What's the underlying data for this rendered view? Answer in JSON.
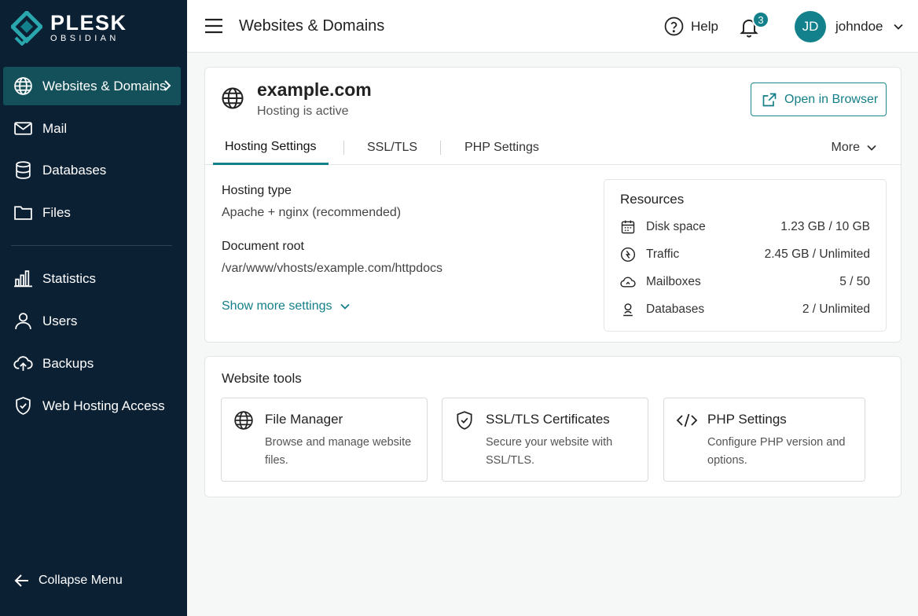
{
  "brand": {
    "name": "PLESK",
    "edition": "OBSIDIAN",
    "accent": "#13818b",
    "sidebar_bg": "#0c2034"
  },
  "sidebar": {
    "items": [
      {
        "label": "Websites & Domains",
        "icon": "globe-icon",
        "active": true
      },
      {
        "label": "Mail",
        "icon": "mail-icon"
      },
      {
        "label": "Databases",
        "icon": "database-icon"
      },
      {
        "label": "Files",
        "icon": "folder-icon"
      },
      {
        "label": "Statistics",
        "icon": "bar-chart-icon"
      },
      {
        "label": "Users",
        "icon": "user-icon"
      },
      {
        "label": "Backups",
        "icon": "cloud-upload-icon"
      },
      {
        "label": "Web Hosting Access",
        "icon": "shield-icon"
      }
    ],
    "collapse_label": "Collapse Menu"
  },
  "header": {
    "title": "Websites & Domains",
    "help_label": "Help",
    "notifications_count": "3",
    "user_initials": "JD",
    "username": "johndoe"
  },
  "domain": {
    "name": "example.com",
    "status": "Hosting is active",
    "open_browser_label": "Open in Browser",
    "tabs": [
      {
        "label": "Hosting Settings",
        "active": true
      },
      {
        "label": "SSL/TLS"
      },
      {
        "label": "PHP Settings"
      }
    ],
    "more_label": "More",
    "hosting_type_label": "Hosting type",
    "hosting_type_value": "Apache + nginx (recommended)",
    "document_root_label": "Document root",
    "document_root_value": "/var/www/vhosts/example.com/httpdocs",
    "show_more_label": "Show more settings"
  },
  "resources": {
    "title": "Resources",
    "rows": [
      {
        "label": "Disk space",
        "value": "1.23 GB / 10 GB",
        "icon": "calendar-icon"
      },
      {
        "label": "Traffic",
        "value": "2.45 GB / Unlimited",
        "icon": "traffic-icon"
      },
      {
        "label": "Mailboxes",
        "value": "5 / 50",
        "icon": "cloud-icon"
      },
      {
        "label": "Databases",
        "value": "2 / Unlimited",
        "icon": "database-user-icon"
      }
    ]
  },
  "tools": {
    "title": "Website tools",
    "items": [
      {
        "title": "File Manager",
        "desc": "Browse and manage website files.",
        "icon": "globe-icon"
      },
      {
        "title": "SSL/TLS Certificates",
        "desc": "Secure your website with SSL/TLS.",
        "icon": "shield-icon"
      },
      {
        "title": "PHP Settings",
        "desc": "Configure PHP version and options.",
        "icon": "code-icon"
      }
    ]
  }
}
